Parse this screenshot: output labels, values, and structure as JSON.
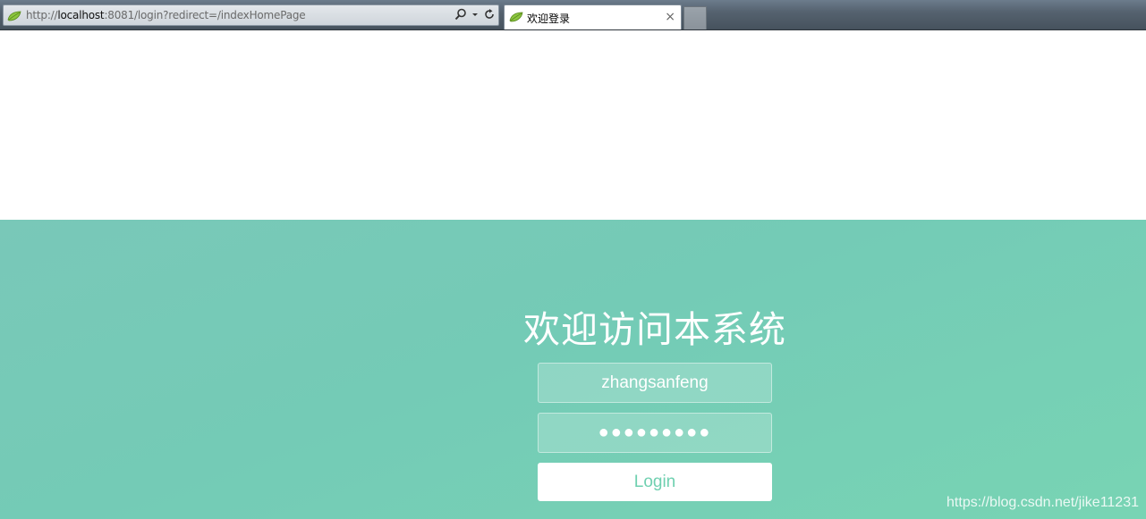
{
  "browser": {
    "url_prefix": "http://",
    "url_host": "localhost",
    "url_rest": ":8081/login?redirect=/indexHomePage",
    "tab_title": "欢迎登录",
    "tab_close": "×",
    "icons": {
      "favicon": "green-leaf-icon",
      "search": "magnifier-icon",
      "dropdown": "chevron-down-icon",
      "refresh": "refresh-icon"
    }
  },
  "login": {
    "title": "欢迎访问本系统",
    "username_value": "zhangsanfeng",
    "password_value": "●●●●●●●●●",
    "button_label": "Login"
  },
  "watermark": "https://blog.csdn.net/jike11231",
  "colors": {
    "background_teal": "#76cbb7",
    "button_text": "#6fd0b0",
    "chrome_dark": "#46525d"
  }
}
